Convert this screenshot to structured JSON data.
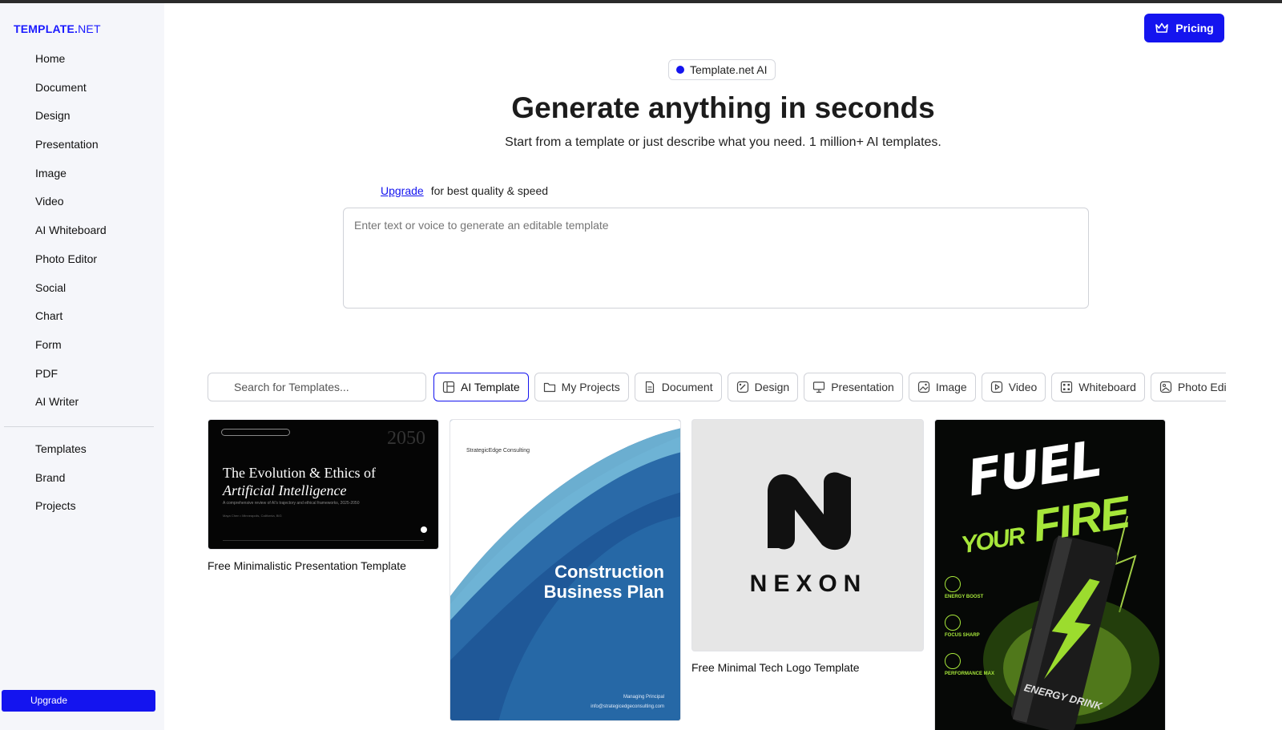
{
  "sidebar": {
    "logo_bold": "TEMPLATE.",
    "logo_light": "NET",
    "nav": [
      "Home",
      "Document",
      "Design",
      "Presentation",
      "Image",
      "Video",
      "AI Whiteboard",
      "Photo Editor",
      "Social",
      "Chart",
      "Form",
      "PDF",
      "AI Writer"
    ],
    "secondary": [
      "Templates",
      "Brand",
      "Projects"
    ],
    "upgrade_label": "Upgrade"
  },
  "header": {
    "pricing_label": "Pricing"
  },
  "hero": {
    "badge": "Template.net AI",
    "title": "Generate anything in seconds",
    "subtitle": "Start from a template or just describe what you need. 1 million+ AI templates.",
    "upgrade_link": "Upgrade",
    "upgrade_text": "for best quality & speed",
    "prompt_placeholder": "Enter text or voice to generate an editable template"
  },
  "search": {
    "placeholder": "Search for Templates..."
  },
  "chips": [
    {
      "label": "AI Template",
      "icon": "layout-icon",
      "active": true
    },
    {
      "label": "My Projects",
      "icon": "folder-icon"
    },
    {
      "label": "Document",
      "icon": "document-icon"
    },
    {
      "label": "Design",
      "icon": "design-icon"
    },
    {
      "label": "Presentation",
      "icon": "presentation-icon"
    },
    {
      "label": "Image",
      "icon": "image-icon"
    },
    {
      "label": "Video",
      "icon": "video-icon"
    },
    {
      "label": "Whiteboard",
      "icon": "whiteboard-icon"
    },
    {
      "label": "Photo Editor",
      "icon": "photo-editor-icon"
    }
  ],
  "templates": [
    {
      "title": "Free Minimalistic Presentation Template",
      "thumb_year": "2050",
      "thumb_heading_1": "The Evolution & Ethics of",
      "thumb_heading_2": "Artificial Intelligence",
      "thumb_sub": "A comprehensive review of AI's trajectory and ethical frameworks, 2025-2050",
      "thumb_meta": "Maya Chen • Minneapolis, California, BIG"
    },
    {
      "title": "",
      "thumb_company": "StrategicEdge Consulting",
      "thumb_heading_1": "Construction",
      "thumb_heading_2": "Business Plan",
      "thumb_footer_1": "Managing Principal",
      "thumb_footer_2": "info@strategicedgeconsulting.com"
    },
    {
      "title": "Free Minimal Tech Logo Template",
      "thumb_wordmark": "NEXON"
    },
    {
      "title": "",
      "thumb_line_1": "FUEL",
      "thumb_line_2a": "YOUR",
      "thumb_line_2b": "FIRE",
      "thumb_features": [
        "ENERGY BOOST",
        "FOCUS SHARP",
        "PERFORMANCE MAX"
      ],
      "thumb_can": "ENERGY DRINK"
    }
  ],
  "colors": {
    "accent": "#1414ef",
    "sidebar_bg": "#f5f6fa",
    "lime": "#a6e63a"
  }
}
